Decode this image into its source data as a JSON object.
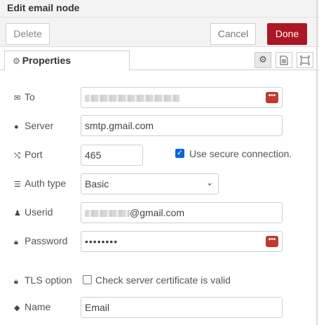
{
  "dialog": {
    "title": "Edit email node"
  },
  "toolbar": {
    "delete_label": "Delete",
    "cancel_label": "Cancel",
    "done_label": "Done"
  },
  "tabs": {
    "properties_label": "Properties"
  },
  "form": {
    "to": {
      "label": "To"
    },
    "server": {
      "label": "Server",
      "value": "smtp.gmail.com"
    },
    "port": {
      "label": "Port",
      "value": "465",
      "secure_label": "Use secure connection.",
      "secure_checked": true
    },
    "auth_type": {
      "label": "Auth type",
      "value": "Basic"
    },
    "userid": {
      "label": "Userid",
      "value_suffix": "@gmail.com"
    },
    "password": {
      "label": "Password",
      "value": "••••••••"
    },
    "tls": {
      "label": "TLS option",
      "check_label": "Check server certificate is valid",
      "checked": false
    },
    "name": {
      "label": "Name",
      "value": "Email"
    }
  },
  "colors": {
    "done_button": "#ad1625",
    "checkbox_checked": "#0a66d8",
    "lock_button": "#c0392b"
  }
}
